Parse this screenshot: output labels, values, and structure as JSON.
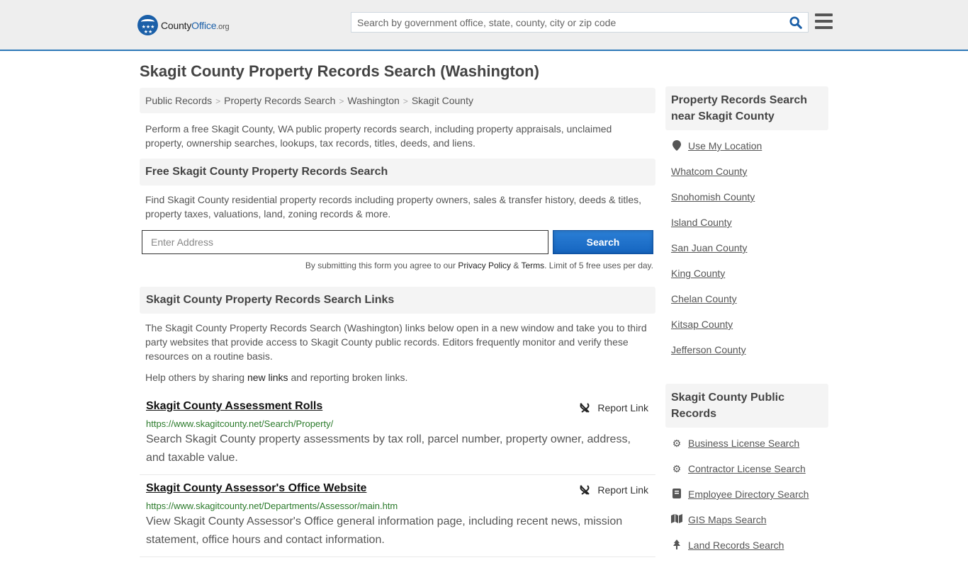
{
  "header": {
    "logo": {
      "part1": "County",
      "part2": "Office",
      "part3": ".org"
    },
    "search_placeholder": "Search by government office, state, county, city or zip code",
    "accent_color": "#2e79b8"
  },
  "page_title": "Skagit County Property Records Search (Washington)",
  "breadcrumb": [
    "Public Records",
    "Property Records Search",
    "Washington",
    "Skagit County"
  ],
  "intro": "Perform a free Skagit County, WA public property records search, including property appraisals, unclaimed property, ownership searches, lookups, tax records, titles, deeds, and liens.",
  "free_search": {
    "heading": "Free Skagit County Property Records Search",
    "description": "Find Skagit County residential property records including property owners, sales & transfer history, deeds & titles, property taxes, valuations, land, zoning records & more.",
    "address_placeholder": "Enter Address",
    "button_label": "Search",
    "disclaimer_pre": "By submitting this form you agree to our ",
    "privacy_label": "Privacy Policy",
    "amp": " & ",
    "terms_label": "Terms",
    "disclaimer_post": ". Limit of 5 free uses per day."
  },
  "links_section": {
    "heading": "Skagit County Property Records Search Links",
    "description": "The Skagit County Property Records Search (Washington) links below open in a new window and take you to third party websites that provide access to Skagit County public records. Editors frequently monitor and verify these resources on a routine basis.",
    "help_pre": "Help others by sharing ",
    "help_link": "new links",
    "help_post": " and reporting broken links.",
    "report_label": "Report Link",
    "records": [
      {
        "title": "Skagit County Assessment Rolls",
        "url": "https://www.skagitcounty.net/Search/Property/",
        "description": "Search Skagit County property assessments by tax roll, parcel number, property owner, address, and taxable value."
      },
      {
        "title": "Skagit County Assessor's Office Website",
        "url": "https://www.skagitcounty.net/Departments/Assessor/main.htm",
        "description": "View Skagit County Assessor's Office general information page, including recent news, mission statement, office hours and contact information."
      }
    ]
  },
  "sidebar": {
    "nearby_heading": "Property Records Search near Skagit County",
    "use_location": "Use My Location",
    "nearby": [
      "Whatcom County",
      "Snohomish County",
      "Island County",
      "San Juan County",
      "King County",
      "Chelan County",
      "Kitsap County",
      "Jefferson County"
    ],
    "public_heading": "Skagit County Public Records",
    "public_records": [
      {
        "label": "Business License Search",
        "icon": "cogs-icon"
      },
      {
        "label": "Contractor License Search",
        "icon": "gear-icon"
      },
      {
        "label": "Employee Directory Search",
        "icon": "book-icon"
      },
      {
        "label": "GIS Maps Search",
        "icon": "map-icon"
      },
      {
        "label": "Land Records Search",
        "icon": "tree-icon"
      }
    ]
  }
}
